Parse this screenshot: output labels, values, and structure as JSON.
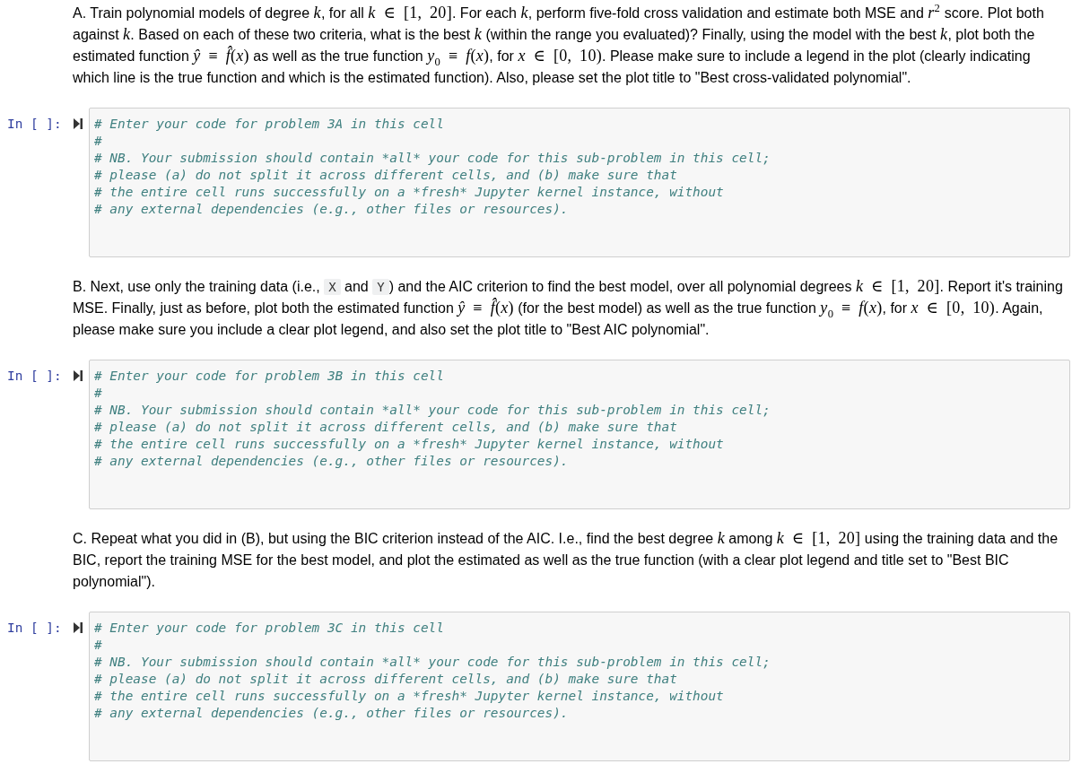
{
  "cells": [
    {
      "kind": "markdown",
      "segments": [
        {
          "kind": "text",
          "text": "A. Train polynomial models of degree "
        },
        {
          "kind": "math",
          "text": "*k*"
        },
        {
          "kind": "text",
          "text": ", for all "
        },
        {
          "kind": "math",
          "text": "*k* ∈ [1, 20]"
        },
        {
          "kind": "text",
          "text": ". For each "
        },
        {
          "kind": "math",
          "text": "*k*"
        },
        {
          "kind": "text",
          "text": ", perform five-fold cross validation and estimate both MSE and "
        },
        {
          "kind": "math",
          "text": "*r*$^{2}$"
        },
        {
          "kind": "text",
          "text": " score. Plot both against "
        },
        {
          "kind": "math",
          "text": "*k*"
        },
        {
          "kind": "text",
          "text": ". Based on each of these two criteria, what is the best "
        },
        {
          "kind": "math",
          "text": "*k*"
        },
        {
          "kind": "text",
          "text": " (within the range you evaluated)? Finally, using the model with the best "
        },
        {
          "kind": "math",
          "text": "*k*"
        },
        {
          "kind": "text",
          "text": ", plot both the estimated function "
        },
        {
          "kind": "math",
          "text": "*ŷ* ≡ *f̂*(*x*)"
        },
        {
          "kind": "text",
          "text": " as well as the true function "
        },
        {
          "kind": "math",
          "text": "*y*$_{0}$ ≡ *f*(*x*)"
        },
        {
          "kind": "text",
          "text": ", for "
        },
        {
          "kind": "math",
          "text": "*x* ∈ [0, 10)"
        },
        {
          "kind": "text",
          "text": ". Please make sure to include a legend in the plot (clearly indicating which line is the true function and which is the estimated function). Also, please set the plot title to \"Best cross-validated polynomial\"."
        }
      ]
    },
    {
      "kind": "code",
      "prompt": "In [ ]:",
      "lines": [
        "# Enter your code for problem 3A in this cell",
        "#",
        "# NB. Your submission should contain *all* your code for this sub-problem in this cell;",
        "# please (a) do not split it across different cells, and (b) make sure that",
        "# the entire cell runs successfully on a *fresh* Jupyter kernel instance, without",
        "# any external dependencies (e.g., other files or resources)."
      ]
    },
    {
      "kind": "markdown",
      "segments": [
        {
          "kind": "text",
          "text": "B. Next, use only the training data (i.e., "
        },
        {
          "kind": "code",
          "text": "X"
        },
        {
          "kind": "text",
          "text": " and "
        },
        {
          "kind": "code",
          "text": "Y"
        },
        {
          "kind": "text",
          "text": ") and the AIC criterion to find the best model, over all polynomial degrees "
        },
        {
          "kind": "math",
          "text": "*k* ∈ [1, 20]"
        },
        {
          "kind": "text",
          "text": ". Report it's training MSE. Finally, just as before, plot both the estimated function "
        },
        {
          "kind": "math",
          "text": "*ŷ* ≡ *f̂*(*x*)"
        },
        {
          "kind": "text",
          "text": " (for the best model) as well as the true function "
        },
        {
          "kind": "math",
          "text": "*y*$_{0}$ ≡ *f*(*x*)"
        },
        {
          "kind": "text",
          "text": ", for "
        },
        {
          "kind": "math",
          "text": "*x* ∈ [0, 10)"
        },
        {
          "kind": "text",
          "text": ". Again, please make sure you include a clear plot legend, and also set the plot title to \"Best AIC polynomial\"."
        }
      ]
    },
    {
      "kind": "code",
      "prompt": "In [ ]:",
      "lines": [
        "# Enter your code for problem 3B in this cell",
        "#",
        "# NB. Your submission should contain *all* your code for this sub-problem in this cell;",
        "# please (a) do not split it across different cells, and (b) make sure that",
        "# the entire cell runs successfully on a *fresh* Jupyter kernel instance, without",
        "# any external dependencies (e.g., other files or resources)."
      ]
    },
    {
      "kind": "markdown",
      "segments": [
        {
          "kind": "text",
          "text": "C. Repeat what you did in (B), but using the BIC criterion instead of the AIC. I.e., find the best degree "
        },
        {
          "kind": "math",
          "text": "*k*"
        },
        {
          "kind": "text",
          "text": " among "
        },
        {
          "kind": "math",
          "text": "*k* ∈ [1, 20]"
        },
        {
          "kind": "text",
          "text": " using the training data and the BIC, report the training MSE for the best model, and plot the estimated as well as the true function (with a clear plot legend and title set to \"Best BIC polynomial\")."
        }
      ]
    },
    {
      "kind": "code",
      "prompt": "In [ ]:",
      "lines": [
        "# Enter your code for problem 3C in this cell",
        "#",
        "# NB. Your submission should contain *all* your code for this sub-problem in this cell;",
        "# please (a) do not split it across different cells, and (b) make sure that",
        "# the entire cell runs successfully on a *fresh* Jupyter kernel instance, without",
        "# any external dependencies (e.g., other files or resources)."
      ]
    }
  ]
}
